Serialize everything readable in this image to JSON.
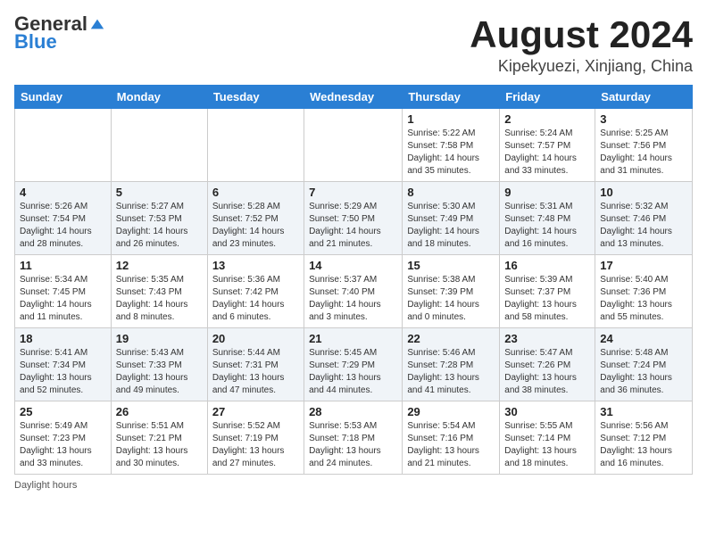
{
  "header": {
    "logo_general": "General",
    "logo_blue": "Blue",
    "month_title": "August 2024",
    "location": "Kipekyuezi, Xinjiang, China"
  },
  "days_of_week": [
    "Sunday",
    "Monday",
    "Tuesday",
    "Wednesday",
    "Thursday",
    "Friday",
    "Saturday"
  ],
  "weeks": [
    [
      {
        "day": "",
        "info": ""
      },
      {
        "day": "",
        "info": ""
      },
      {
        "day": "",
        "info": ""
      },
      {
        "day": "",
        "info": ""
      },
      {
        "day": "1",
        "info": "Sunrise: 5:22 AM\nSunset: 7:58 PM\nDaylight: 14 hours\nand 35 minutes."
      },
      {
        "day": "2",
        "info": "Sunrise: 5:24 AM\nSunset: 7:57 PM\nDaylight: 14 hours\nand 33 minutes."
      },
      {
        "day": "3",
        "info": "Sunrise: 5:25 AM\nSunset: 7:56 PM\nDaylight: 14 hours\nand 31 minutes."
      }
    ],
    [
      {
        "day": "4",
        "info": "Sunrise: 5:26 AM\nSunset: 7:54 PM\nDaylight: 14 hours\nand 28 minutes."
      },
      {
        "day": "5",
        "info": "Sunrise: 5:27 AM\nSunset: 7:53 PM\nDaylight: 14 hours\nand 26 minutes."
      },
      {
        "day": "6",
        "info": "Sunrise: 5:28 AM\nSunset: 7:52 PM\nDaylight: 14 hours\nand 23 minutes."
      },
      {
        "day": "7",
        "info": "Sunrise: 5:29 AM\nSunset: 7:50 PM\nDaylight: 14 hours\nand 21 minutes."
      },
      {
        "day": "8",
        "info": "Sunrise: 5:30 AM\nSunset: 7:49 PM\nDaylight: 14 hours\nand 18 minutes."
      },
      {
        "day": "9",
        "info": "Sunrise: 5:31 AM\nSunset: 7:48 PM\nDaylight: 14 hours\nand 16 minutes."
      },
      {
        "day": "10",
        "info": "Sunrise: 5:32 AM\nSunset: 7:46 PM\nDaylight: 14 hours\nand 13 minutes."
      }
    ],
    [
      {
        "day": "11",
        "info": "Sunrise: 5:34 AM\nSunset: 7:45 PM\nDaylight: 14 hours\nand 11 minutes."
      },
      {
        "day": "12",
        "info": "Sunrise: 5:35 AM\nSunset: 7:43 PM\nDaylight: 14 hours\nand 8 minutes."
      },
      {
        "day": "13",
        "info": "Sunrise: 5:36 AM\nSunset: 7:42 PM\nDaylight: 14 hours\nand 6 minutes."
      },
      {
        "day": "14",
        "info": "Sunrise: 5:37 AM\nSunset: 7:40 PM\nDaylight: 14 hours\nand 3 minutes."
      },
      {
        "day": "15",
        "info": "Sunrise: 5:38 AM\nSunset: 7:39 PM\nDaylight: 14 hours\nand 0 minutes."
      },
      {
        "day": "16",
        "info": "Sunrise: 5:39 AM\nSunset: 7:37 PM\nDaylight: 13 hours\nand 58 minutes."
      },
      {
        "day": "17",
        "info": "Sunrise: 5:40 AM\nSunset: 7:36 PM\nDaylight: 13 hours\nand 55 minutes."
      }
    ],
    [
      {
        "day": "18",
        "info": "Sunrise: 5:41 AM\nSunset: 7:34 PM\nDaylight: 13 hours\nand 52 minutes."
      },
      {
        "day": "19",
        "info": "Sunrise: 5:43 AM\nSunset: 7:33 PM\nDaylight: 13 hours\nand 49 minutes."
      },
      {
        "day": "20",
        "info": "Sunrise: 5:44 AM\nSunset: 7:31 PM\nDaylight: 13 hours\nand 47 minutes."
      },
      {
        "day": "21",
        "info": "Sunrise: 5:45 AM\nSunset: 7:29 PM\nDaylight: 13 hours\nand 44 minutes."
      },
      {
        "day": "22",
        "info": "Sunrise: 5:46 AM\nSunset: 7:28 PM\nDaylight: 13 hours\nand 41 minutes."
      },
      {
        "day": "23",
        "info": "Sunrise: 5:47 AM\nSunset: 7:26 PM\nDaylight: 13 hours\nand 38 minutes."
      },
      {
        "day": "24",
        "info": "Sunrise: 5:48 AM\nSunset: 7:24 PM\nDaylight: 13 hours\nand 36 minutes."
      }
    ],
    [
      {
        "day": "25",
        "info": "Sunrise: 5:49 AM\nSunset: 7:23 PM\nDaylight: 13 hours\nand 33 minutes."
      },
      {
        "day": "26",
        "info": "Sunrise: 5:51 AM\nSunset: 7:21 PM\nDaylight: 13 hours\nand 30 minutes."
      },
      {
        "day": "27",
        "info": "Sunrise: 5:52 AM\nSunset: 7:19 PM\nDaylight: 13 hours\nand 27 minutes."
      },
      {
        "day": "28",
        "info": "Sunrise: 5:53 AM\nSunset: 7:18 PM\nDaylight: 13 hours\nand 24 minutes."
      },
      {
        "day": "29",
        "info": "Sunrise: 5:54 AM\nSunset: 7:16 PM\nDaylight: 13 hours\nand 21 minutes."
      },
      {
        "day": "30",
        "info": "Sunrise: 5:55 AM\nSunset: 7:14 PM\nDaylight: 13 hours\nand 18 minutes."
      },
      {
        "day": "31",
        "info": "Sunrise: 5:56 AM\nSunset: 7:12 PM\nDaylight: 13 hours\nand 16 minutes."
      }
    ]
  ],
  "footer": {
    "note": "Daylight hours"
  }
}
